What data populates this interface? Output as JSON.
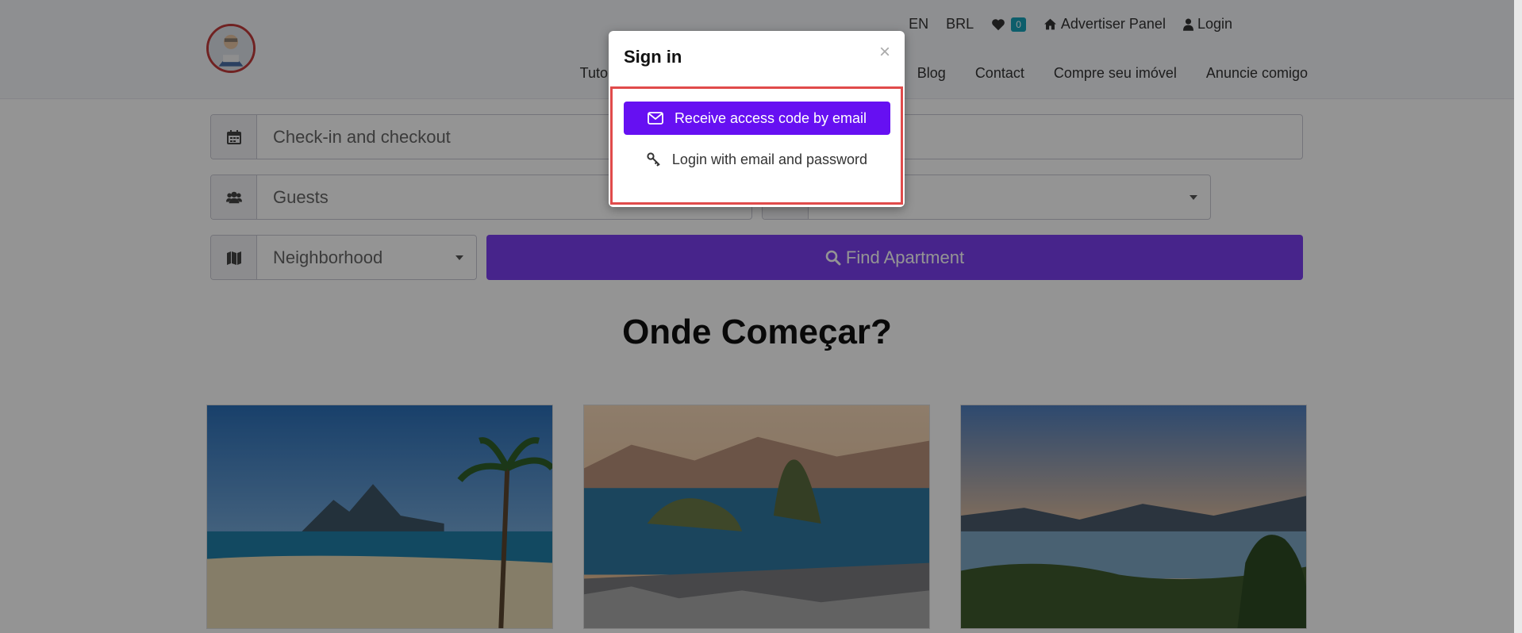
{
  "header": {
    "lang": "EN",
    "currency": "BRL",
    "favorites_count": "0",
    "advertiser_panel": "Advertiser Panel",
    "login": "Login",
    "nav": {
      "tutorial": "Tutorial",
      "blog": "Blog",
      "contact": "Contact",
      "buy": "Compre seu imóvel",
      "advertise": "Anuncie comigo"
    }
  },
  "search": {
    "dates_placeholder": "Check-in and checkout",
    "guests_placeholder": "Guests",
    "neighborhood_placeholder": "Neighborhood",
    "find_button": "Find Apartment"
  },
  "main": {
    "section_title": "Onde Começar?"
  },
  "modal": {
    "title": "Sign in",
    "close": "×",
    "email_code_button": "Receive access code by email",
    "password_login_link": "Login with email and password"
  },
  "colors": {
    "primary": "#6610f2",
    "find_button": "#7a3ff0",
    "highlight": "#e04b4b",
    "badge": "#17a2b8"
  },
  "icons": [
    "calendar-icon",
    "users-icon",
    "map-icon",
    "search-icon",
    "heart-icon",
    "home-icon",
    "user-icon",
    "envelope-icon",
    "key-icon"
  ]
}
